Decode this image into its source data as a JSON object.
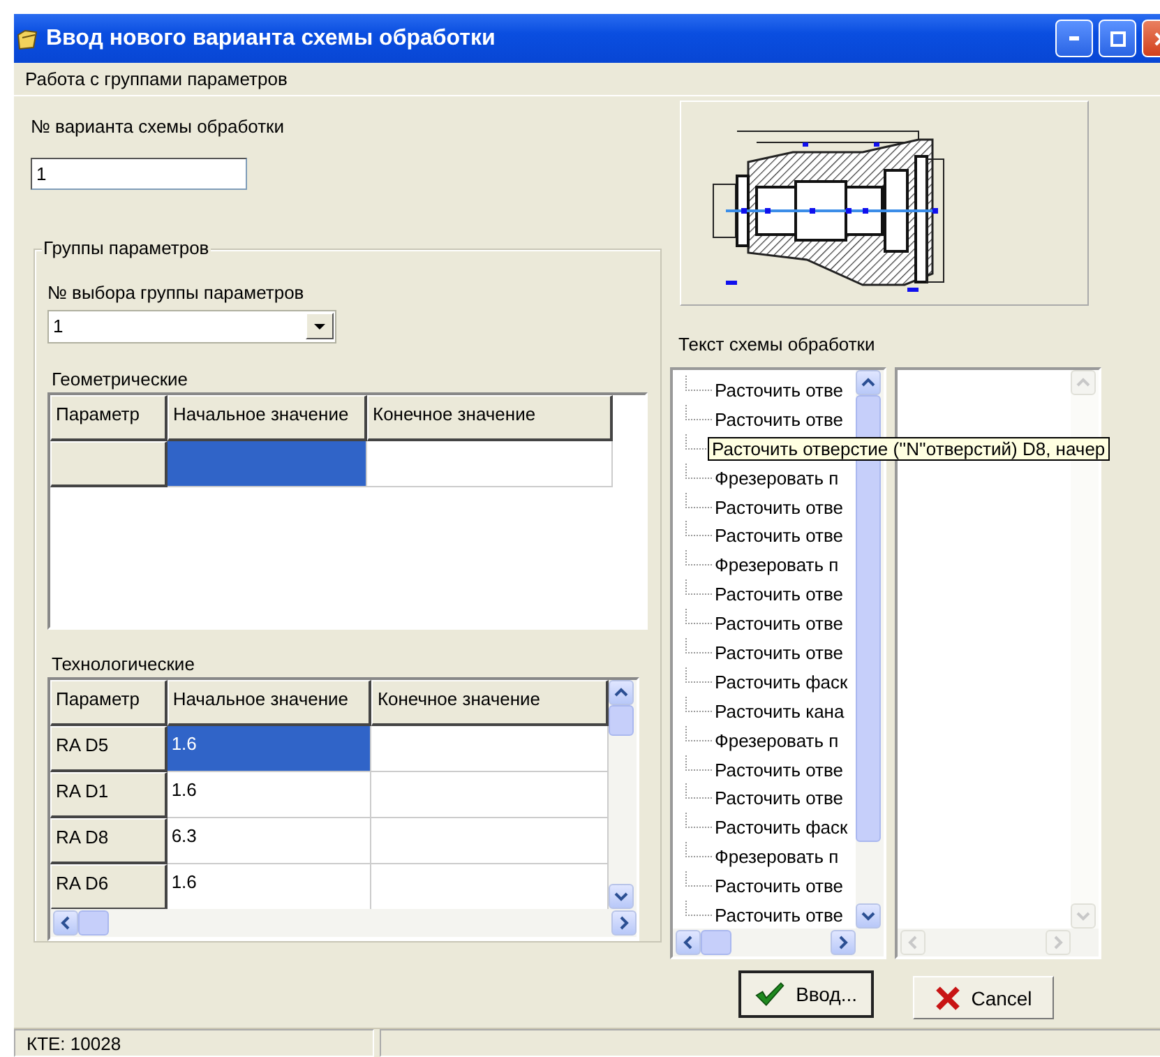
{
  "window": {
    "title": "Ввод нового варианта схемы обработки"
  },
  "menu": [
    "Работа с группами параметров"
  ],
  "variant": {
    "label": "№ варианта схемы обработки",
    "value": "1"
  },
  "groups": {
    "title": "Группы параметров",
    "select_label": "№ выбора группы параметров",
    "select_value": "1",
    "geometric": {
      "title": "Геометрические",
      "columns": [
        "Параметр",
        "Начальное значение",
        "Конечное значение"
      ],
      "rows": [
        {
          "selected": true
        }
      ]
    },
    "technological": {
      "title": "Технологические",
      "columns": [
        "Параметр",
        "Начальное значение",
        "Конечное значение"
      ],
      "rows": [
        {
          "parameter": "RA D5",
          "start": "1.6",
          "selected": true
        },
        {
          "parameter": "RA D1",
          "start": "1.6",
          "selected": false
        },
        {
          "parameter": "RA D8",
          "start": "6.3",
          "selected": false
        },
        {
          "parameter": "RA D6",
          "start": "1.6",
          "selected": false
        }
      ]
    }
  },
  "scheme": {
    "title": "Текст схемы обработки",
    "items": [
      {
        "text": "Расточить отве",
        "hovered": false
      },
      {
        "text": "Расточить отве",
        "hovered": false
      },
      {
        "text": "Расточить отверстие   (''N''отверстий) D8, начер",
        "hovered": true
      },
      {
        "text": "Фрезеровать п",
        "hovered": false
      },
      {
        "text": "Расточить отве",
        "hovered": false
      },
      {
        "text": "Расточить отве",
        "hovered": false
      },
      {
        "text": "Фрезеровать п",
        "hovered": false
      },
      {
        "text": "Расточить отве",
        "hovered": false
      },
      {
        "text": "Расточить отве",
        "hovered": false
      },
      {
        "text": "Расточить отве",
        "hovered": false
      },
      {
        "text": "Расточить фаск",
        "hovered": false
      },
      {
        "text": "Расточить кана",
        "hovered": false
      },
      {
        "text": "Фрезеровать п",
        "hovered": false
      },
      {
        "text": "Расточить отве",
        "hovered": false
      },
      {
        "text": "Расточить отве",
        "hovered": false
      },
      {
        "text": "Расточить фаск",
        "hovered": false
      },
      {
        "text": "Фрезеровать п",
        "hovered": false
      },
      {
        "text": "Расточить отве",
        "hovered": false
      },
      {
        "text": "Расточить отве",
        "hovered": false
      }
    ]
  },
  "buttons": [
    {
      "kind": "ok",
      "label": "Ввод..."
    },
    {
      "kind": "cancel",
      "label": "Cancel"
    }
  ],
  "status_bar": [
    "КТЕ: 10028"
  ]
}
